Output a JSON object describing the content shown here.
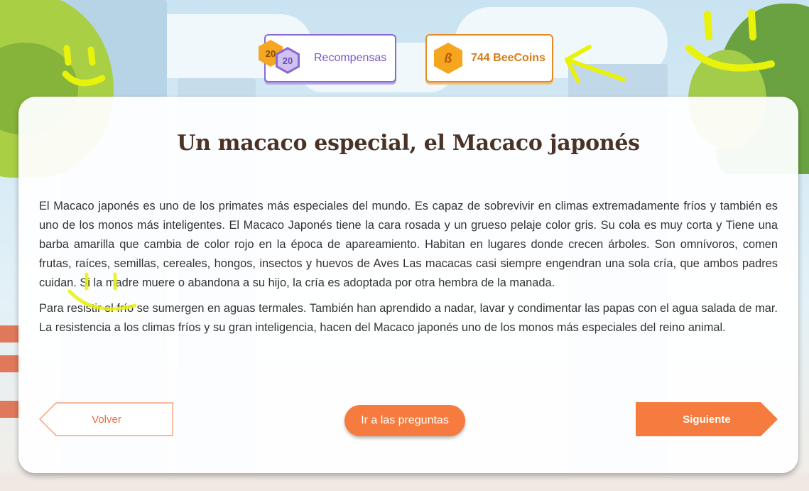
{
  "header": {
    "rewards": {
      "level_gold": "20",
      "level_purple": "20",
      "label": "Recompensas"
    },
    "coins": {
      "icon": "b-coin-icon",
      "label": "744 BeeCoins"
    }
  },
  "reading": {
    "title": "Un macaco especial, el Macaco japonés",
    "paragraphs": [
      "El Macaco japonés es uno de los primates más especiales del mundo. Es capaz de sobrevivir en climas extremadamente fríos y también es uno de los monos más inteligentes. El Macaco Japonés tiene la cara rosada y un grueso pelaje color gris. Su cola es muy corta y Tiene una barba amarilla que cambia de color rojo en la época de apareamiento. Habitan en lugares donde crecen árboles. Son omnívoros, comen frutas, raíces, semillas, cereales, hongos, insectos y huevos de Aves Las macacas casi siempre engendran una sola cría, que ambos padres cuidan. Si la madre muere o abandona a su hijo, la cría es adoptada por otra hembra de la manada.",
      "Para resistir el frío se sumergen en aguas termales. También han aprendido a nadar, lavar y condimentar las papas con el agua salada de mar. La resistencia a los climas fríos y su gran inteligencia, hacen del Macaco japonés uno de los monos más especiales del reino animal."
    ]
  },
  "nav": {
    "back_label": "Volver",
    "questions_label": "Ir a las preguntas",
    "next_label": "Siguiente"
  },
  "colors": {
    "accent_orange": "#f57b3e",
    "rewards_purple": "#8a6ad0",
    "coins_orange": "#e38a24",
    "title_brown": "#4a3326",
    "doodle_yellow": "#e8f20a"
  }
}
